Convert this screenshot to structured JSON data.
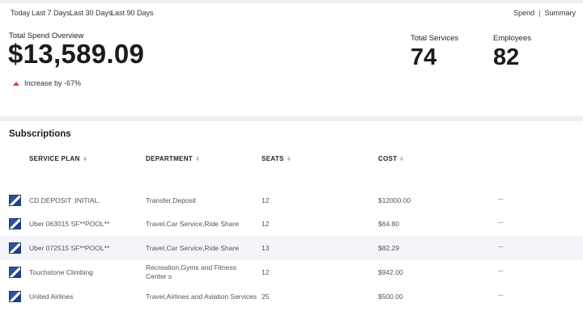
{
  "range_tabs": [
    "Today",
    "Last 7 Days",
    "Last 30 Days",
    "Last 90 Days"
  ],
  "view_switch": {
    "spend": "Spend",
    "separator": "|",
    "summary": "Summary"
  },
  "overview": {
    "label": "Total Spend Overview",
    "amount": "$13,589.09",
    "trend_text": "Increase by -67%",
    "trend_color": "#e53935"
  },
  "stats": [
    {
      "label": "Total Services",
      "value": "74"
    },
    {
      "label": "Employees",
      "value": "82"
    }
  ],
  "subscriptions": {
    "title": "Subscriptions",
    "columns": [
      "SERVICE PLAN",
      "DEPARTMENT",
      "SEATS",
      "COST"
    ],
    "more_label": "···",
    "rows": [
      {
        "plan": "CD DEPOSIT .INITIAL.",
        "department": "Transfer,Deposit",
        "seats": "12",
        "cost": "$12000.00"
      },
      {
        "plan": "Uber 063015 SF**POOL**",
        "department": "Travel,Car Service,Ride Share",
        "seats": "12",
        "cost": "$64.80"
      },
      {
        "plan": "Uber 072515 SF**POOL**",
        "department": "Travel,Car Service,Ride Share",
        "seats": "13",
        "cost": "$82.29"
      },
      {
        "plan": "Touchstone Climbing",
        "department": "Recreation,Gyms and Fitness Center s",
        "seats": "12",
        "cost": "$942.00"
      },
      {
        "plan": "United Airlines",
        "department": "Travel,Airlines and Aviation Services",
        "seats": "25",
        "cost": "$500.00"
      }
    ]
  }
}
